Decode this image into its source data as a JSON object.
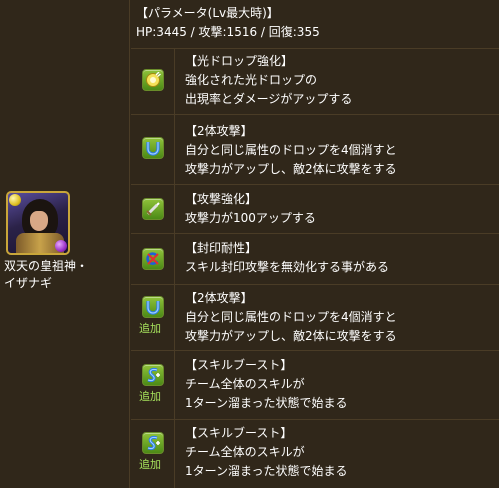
{
  "monster": {
    "name_line1": "双天の皇祖神・",
    "name_line2": "イザナギ"
  },
  "parameters": {
    "heading": "【パラメータ(Lv最大時)】",
    "stats": "HP:3445 / 攻撃:1516 / 回復:355"
  },
  "awakenings": [
    {
      "icon": "light-drop-enhance-icon",
      "added": "",
      "title": "【光ドロップ強化】",
      "lines": [
        "強化された光ドロップの",
        "出現率とダメージがアップする"
      ]
    },
    {
      "icon": "two-pronged-attack-icon",
      "added": "",
      "title": "【2体攻撃】",
      "lines": [
        "自分と同じ属性のドロップを4個消すと",
        "攻撃力がアップし、敵2体に攻撃をする"
      ]
    },
    {
      "icon": "enhanced-attack-icon",
      "added": "",
      "title": "【攻撃強化】",
      "lines": [
        "攻撃力が100アップする"
      ]
    },
    {
      "icon": "skill-bind-resist-icon",
      "added": "",
      "title": "【封印耐性】",
      "lines": [
        "スキル封印攻撃を無効化する事がある"
      ]
    },
    {
      "icon": "two-pronged-attack-icon",
      "added": "追加",
      "title": "【2体攻撃】",
      "lines": [
        "自分と同じ属性のドロップを4個消すと",
        "攻撃力がアップし、敵2体に攻撃をする"
      ]
    },
    {
      "icon": "skill-boost-icon",
      "added": "追加",
      "title": "【スキルブースト】",
      "lines": [
        "チーム全体のスキルが",
        "1ターン溜まった状態で始まる"
      ]
    },
    {
      "icon": "skill-boost-icon",
      "added": "追加",
      "title": "【スキルブースト】",
      "lines": [
        "チーム全体のスキルが",
        "1ターン溜まった状態で始まる"
      ]
    }
  ]
}
